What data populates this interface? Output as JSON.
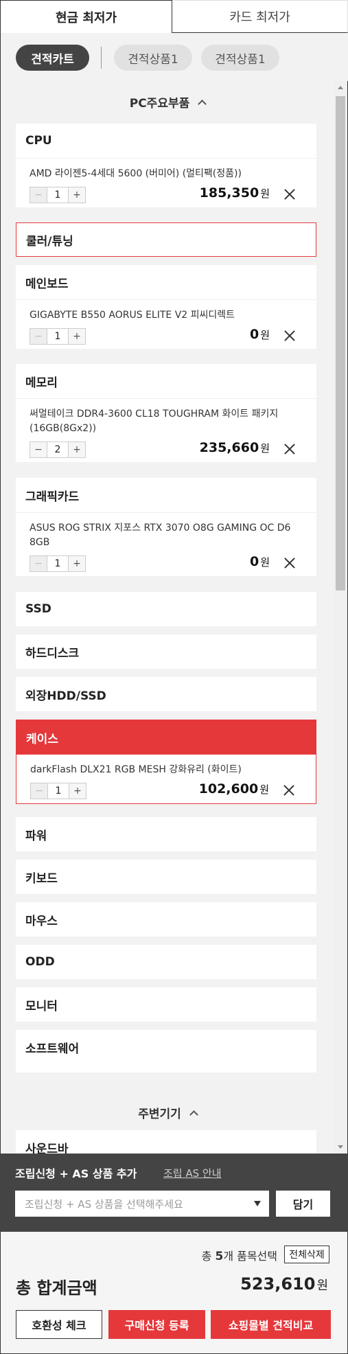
{
  "tabs": {
    "cash": "현금 최저가",
    "card": "카드 최저가"
  },
  "carts": [
    "견적카트",
    "견적상품1",
    "견적상품1"
  ],
  "sections": {
    "pc_main": "PC주요부품",
    "peripherals": "주변기기"
  },
  "categories": {
    "cpu": "CPU",
    "cooler": "쿨러/튜닝",
    "mainboard": "메인보드",
    "memory": "메모리",
    "gpu": "그래픽카드",
    "ssd": "SSD",
    "hdd": "하드디스크",
    "ext": "외장HDD/SSD",
    "case": "케이스",
    "power": "파워",
    "keyboard": "키보드",
    "mouse": "마우스",
    "odd": "ODD",
    "monitor": "모니터",
    "software": "소프트웨어",
    "soundbar": "사운드바"
  },
  "items": {
    "cpu": {
      "name": "AMD 라이젠5-4세대 5600 (버미어) (멀티팩(정품))",
      "qty": "1",
      "price": "185,350"
    },
    "mainboard": {
      "name": "GIGABYTE B550 AORUS ELITE V2 피씨디렉트",
      "qty": "1",
      "price": "0"
    },
    "memory": {
      "name": "써멀테이크 DDR4-3600 CL18 TOUGHRAM 화이트 패키지 (16GB(8Gx2))",
      "qty": "2",
      "price": "235,660"
    },
    "gpu": {
      "name": "ASUS ROG STRIX 지포스 RTX 3070 O8G GAMING OC D6 8GB",
      "qty": "1",
      "price": "0"
    },
    "case": {
      "name": "darkFlash DLX21 RGB MESH 강화유리 (화이트)",
      "qty": "1",
      "price": "102,600"
    }
  },
  "currency": "원",
  "qty_minus": "−",
  "qty_plus": "+",
  "as": {
    "title": "조립신청 + AS 상품 추가",
    "link": "조립 AS 안내",
    "placeholder": "조립신청 + AS 상품을 선택해주세요",
    "button": "담기"
  },
  "summary": {
    "count_prefix": "총 ",
    "count": "5",
    "count_suffix": "개 품목선택",
    "clear": "전체삭제",
    "total_label": "총 합계금액",
    "total": "523,610"
  },
  "buttons": {
    "compat": "호환성 체크",
    "purchase": "구매신청 등록",
    "compare": "쇼핑몰별 견적비교"
  },
  "colors": {
    "accent": "#e5383b",
    "dark": "#444444"
  }
}
